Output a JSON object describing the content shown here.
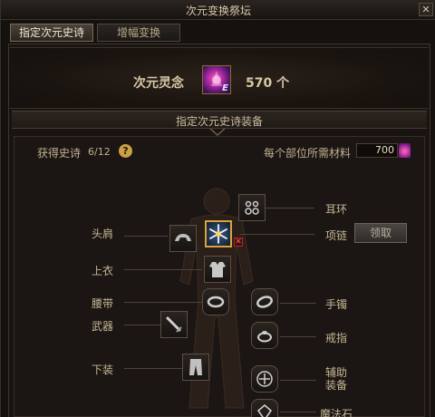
{
  "window": {
    "title": "次元变换祭坛",
    "close_label": "✕"
  },
  "tabs": [
    {
      "label": "指定次元史诗",
      "active": true
    },
    {
      "label": "增幅变换",
      "active": false
    }
  ],
  "material": {
    "name": "次元灵念",
    "count": "570 个",
    "grade": "E",
    "icon": "dimension-soul-icon"
  },
  "section": {
    "title": "指定次元史诗装备"
  },
  "stats": {
    "collected_label": "获得史诗",
    "collected_value": "6/12",
    "help_label": "?",
    "per_slot_label": "每个部位所需材料",
    "per_slot_value": "700"
  },
  "slots": {
    "shoulder": "头肩",
    "top": "上衣",
    "belt": "腰带",
    "weapon": "武器",
    "bottom": "下装",
    "earring": "耳环",
    "necklace": "项链",
    "bracelet": "手镯",
    "ring": "戒指",
    "subequip": "辅助\n装备",
    "magicstone": "魔法石"
  },
  "buttons": {
    "claim": "领取",
    "remove": "✕"
  },
  "colors": {
    "accent_gold": "#d9a43a",
    "background": "#15110f",
    "text": "#c8b898"
  }
}
